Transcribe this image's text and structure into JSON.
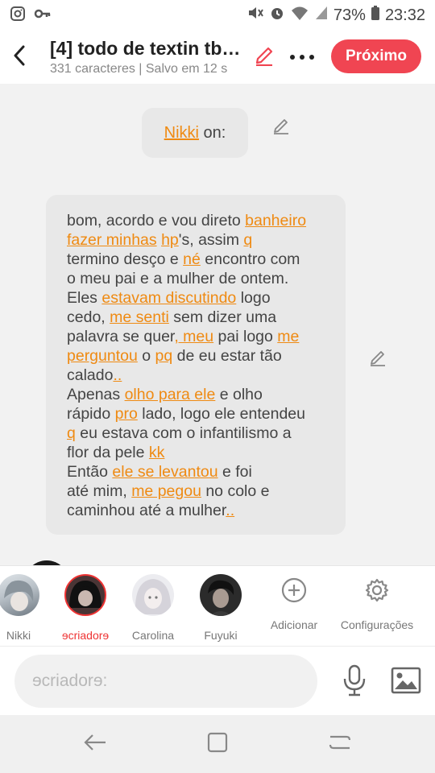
{
  "status_bar": {
    "battery": "73%",
    "time": "23:32",
    "icons": [
      "instagram-icon",
      "key-icon",
      "mute-icon",
      "alarm-icon",
      "wifi-icon",
      "signal-icon",
      "battery-icon"
    ]
  },
  "header": {
    "title": "[4] todo de textin tb…",
    "subtitle": "331 caracteres | Salvo em 12 s",
    "next_label": "Próximo"
  },
  "messages": {
    "first": {
      "speaker": "Nikki",
      "suffix": " on:"
    },
    "second": {
      "lines": [
        [
          {
            "t": "bom, acordo e vou direto "
          },
          {
            "t": "banheiro",
            "l": true
          }
        ],
        [
          {
            "t": "fazer minhas",
            "l": true
          },
          {
            "t": " "
          },
          {
            "t": "hp",
            "l": true
          },
          {
            "t": "'s, assim "
          },
          {
            "t": "q",
            "l": true
          }
        ],
        [
          {
            "t": "termino desço e "
          },
          {
            "t": "né",
            "l": true
          },
          {
            "t": " encontro com"
          }
        ],
        [
          {
            "t": "o meu pai e a mulher de ontem."
          }
        ],
        [
          {
            "t": "Eles "
          },
          {
            "t": "estavam discutindo",
            "l": true
          },
          {
            "t": " logo"
          }
        ],
        [
          {
            "t": "cedo, "
          },
          {
            "t": "me senti",
            "l": true
          },
          {
            "t": " sem dizer uma"
          }
        ],
        [
          {
            "t": "palavra se quer"
          },
          {
            "t": ", meu",
            "l": true
          },
          {
            "t": " pai logo "
          },
          {
            "t": "me",
            "l": true
          }
        ],
        [
          {
            "t": "perguntou",
            "l": true
          },
          {
            "t": " o "
          },
          {
            "t": "pq",
            "l": true
          },
          {
            "t": " de eu estar tão"
          }
        ],
        [
          {
            "t": "calado"
          },
          {
            "t": "..",
            "l": true
          }
        ],
        [
          {
            "t": "Apenas "
          },
          {
            "t": "olho para ele",
            "l": true
          },
          {
            "t": " e olho"
          }
        ],
        [
          {
            "t": "rápido "
          },
          {
            "t": "pro",
            "l": true
          },
          {
            "t": " lado, logo ele entendeu"
          }
        ],
        [
          {
            "t": "q",
            "l": true
          },
          {
            "t": " eu estava com o infantilismo a"
          }
        ],
        [
          {
            "t": "flor da pele "
          },
          {
            "t": "kk",
            "l": true
          }
        ],
        [
          {
            "t": "Então "
          },
          {
            "t": "ele se levantou",
            "l": true
          },
          {
            "t": " e foi"
          }
        ],
        [
          {
            "t": "até mim, "
          },
          {
            "t": "me pegou",
            "l": true
          },
          {
            "t": " no colo e"
          }
        ],
        [
          {
            "t": "caminhou até a mulher"
          },
          {
            "t": "..",
            "l": true
          }
        ]
      ]
    }
  },
  "characters": [
    {
      "name": "Nikki",
      "selected": false
    },
    {
      "name": "ɘcriadorɘ",
      "selected": true
    },
    {
      "name": "Carolina",
      "selected": false
    },
    {
      "name": "Fuyuki",
      "selected": false
    }
  ],
  "actions": {
    "add_label": "Adicionar",
    "settings_label": "Configurações"
  },
  "input": {
    "placeholder": "ɘcriadorɘ:",
    "value": ""
  },
  "colors": {
    "accent": "#f04552",
    "link": "#ef8a12",
    "selected_character": "#ee3333"
  }
}
